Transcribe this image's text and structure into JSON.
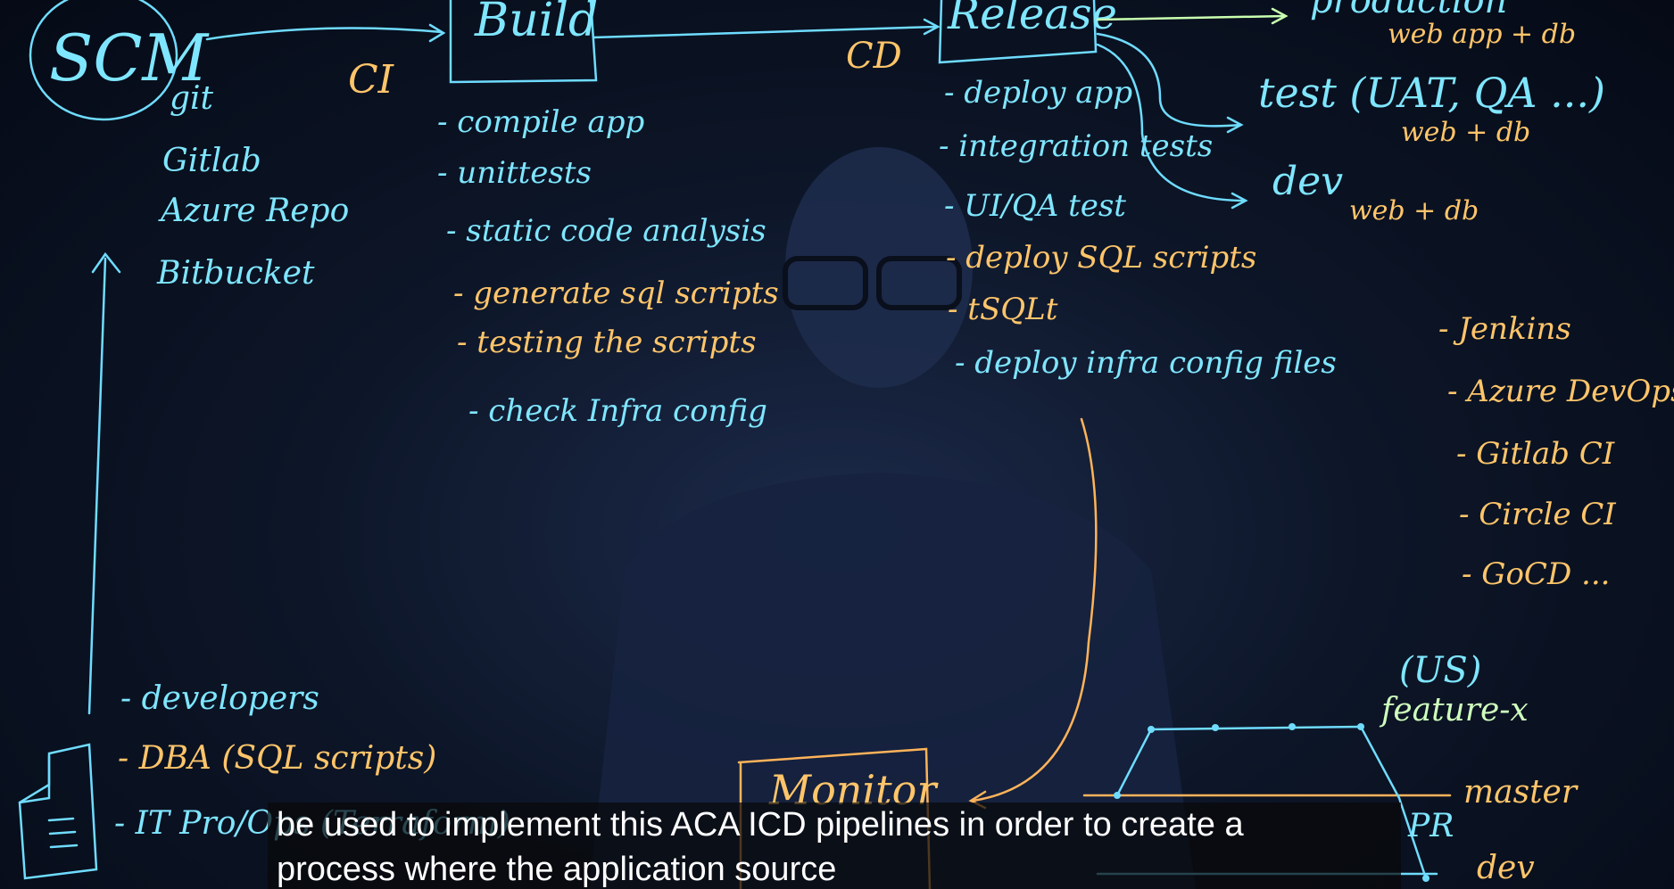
{
  "board": {
    "scm": {
      "title": "SCM",
      "items": [
        "git",
        "Gitlab",
        "Azure Repo",
        "Bitbucket"
      ]
    },
    "ci_label": "CI",
    "cd_label": "CD",
    "build": {
      "title": "Build",
      "items": [
        "- compile app",
        "- unittests",
        "- static code analysis",
        "- generate sql scripts",
        "- testing the scripts",
        "- check Infra config"
      ]
    },
    "release": {
      "title": "Release",
      "items": [
        "- deploy app",
        "- integration tests",
        "- UI/QA test",
        "- deploy SQL scripts",
        "- tSQLt",
        "- deploy infra config files"
      ]
    },
    "environments": {
      "production": "production",
      "production_note": "web app + db",
      "test": "test (UAT, QA ...)",
      "test_note": "web + db",
      "dev": "dev",
      "dev_note": "web + db"
    },
    "tools": [
      "- Jenkins",
      "- Azure DevOps",
      "- Gitlab CI",
      "- Circle CI",
      "- GoCD ..."
    ],
    "people": [
      "- developers",
      "- DBA (SQL scripts)",
      "- IT Pro/Ops (Terraform)"
    ],
    "monitor": "Monitor",
    "branches": {
      "us": "(US)",
      "feature": "feature-x",
      "master": "master",
      "pr": "PR",
      "dev": "dev"
    }
  },
  "subtitle": {
    "line1": "be used to implement this ACA ICD pipelines in order to create a",
    "line2": "process where the application source"
  }
}
